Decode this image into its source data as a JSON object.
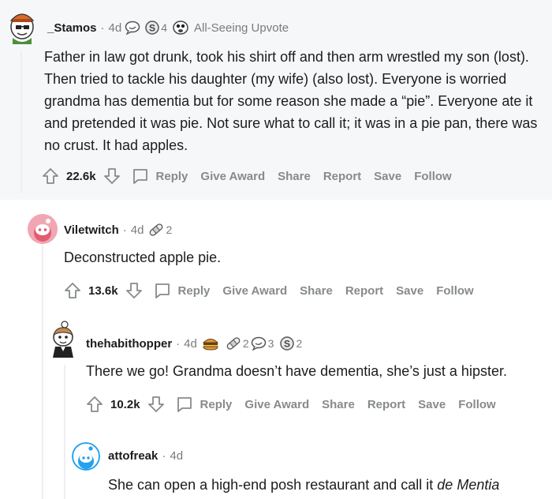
{
  "comments": [
    {
      "username": "_Stamos",
      "age": "4d",
      "awards": [
        {
          "icon": "bubble-award-icon",
          "count": ""
        },
        {
          "icon": "silver-coin-award-icon",
          "count": "4"
        },
        {
          "icon": "all-seeing-upvote-icon",
          "count": ""
        }
      ],
      "award_label": "All-Seeing Upvote",
      "body": "Father in law got drunk, took his shirt off and then arm wrestled my son (lost). Then tried to tackle his daughter (my wife) (also lost). Everyone is worried grandma has dementia but for some reason she made a “pie”. Everyone ate it and pretended it was pie. Not sure what to call it; it was in a pie pan, there was no crust. It had apples.",
      "score": "22.6k"
    },
    {
      "username": "Viletwitch",
      "age": "4d",
      "awards": [
        {
          "icon": "bandage-award-icon",
          "count": "2"
        }
      ],
      "body": "Deconstructed apple pie.",
      "score": "13.6k"
    },
    {
      "username": "thehabithopper",
      "age": "4d",
      "awards": [
        {
          "icon": "burger-award-icon",
          "count": ""
        },
        {
          "icon": "bandage-award-icon",
          "count": "2"
        },
        {
          "icon": "bubble-award-icon",
          "count": "3"
        },
        {
          "icon": "silver-coin-award-icon",
          "count": "2"
        }
      ],
      "body": "There we go! Grandma doesn’t have dementia, she’s just a hipster.",
      "score": "10.2k"
    },
    {
      "username": "attofreak",
      "age": "4d",
      "body_prefix": "She can open a high-end posh restaurant and call it ",
      "body_italic": "de Mentia"
    }
  ],
  "actions": {
    "reply": "Reply",
    "give_award": "Give Award",
    "share": "Share",
    "report": "Report",
    "save": "Save",
    "follow": "Follow"
  },
  "meta_separator": "·",
  "colors": {
    "first_comment_bg": "#f6f7f8",
    "thread_line": "#edeff1",
    "action_gray": "#878a8c",
    "meta_gray": "#787c7e"
  }
}
